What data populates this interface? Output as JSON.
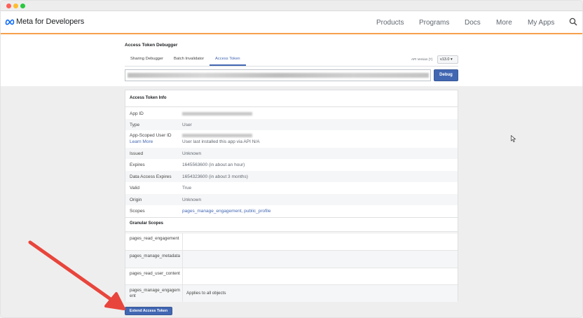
{
  "nav": {
    "brand": "Meta for Developers",
    "items": [
      "Products",
      "Programs",
      "Docs",
      "More",
      "My Apps"
    ]
  },
  "page": {
    "title": "Access Token Debugger",
    "tabs": [
      "Sharing Debugger",
      "Batch Invalidator",
      "Access Token"
    ],
    "api_version_label": "API Version [?]",
    "api_version": "v13.0 ▾",
    "debug_label": "Debug"
  },
  "info": {
    "section_title": "Access Token Info",
    "rows": [
      {
        "label": "App ID",
        "value": ""
      },
      {
        "label": "Type",
        "value": "User"
      },
      {
        "label": "App-Scoped User ID",
        "label2": "Learn More",
        "value": "",
        "value2": "User last installed this app via API N/A"
      },
      {
        "label": "Issued",
        "value": "Unknown"
      },
      {
        "label": "Expires",
        "value": "1645563600 (in about an hour)"
      },
      {
        "label": "Data Access Expires",
        "value": "1654323600 (in about 3 months)"
      },
      {
        "label": "Valid",
        "value": "True"
      },
      {
        "label": "Origin",
        "value": "Unknown"
      },
      {
        "label": "Scopes",
        "value": "pages_manage_engagement, public_profile"
      }
    ]
  },
  "granular": {
    "section_title": "Granular Scopes",
    "rows": [
      {
        "label": "pages_read_engagement",
        "value": ""
      },
      {
        "label": "pages_manage_metadata",
        "value": ""
      },
      {
        "label": "pages_read_user_content",
        "value": ""
      },
      {
        "label": "pages_manage_engagement",
        "value": "Applies to all objects"
      }
    ]
  },
  "extend_label": "Extend Access Token",
  "colors": {
    "accent": "#4267b2",
    "nav_border": "#f6a04d",
    "arrow": "#e8453c"
  }
}
